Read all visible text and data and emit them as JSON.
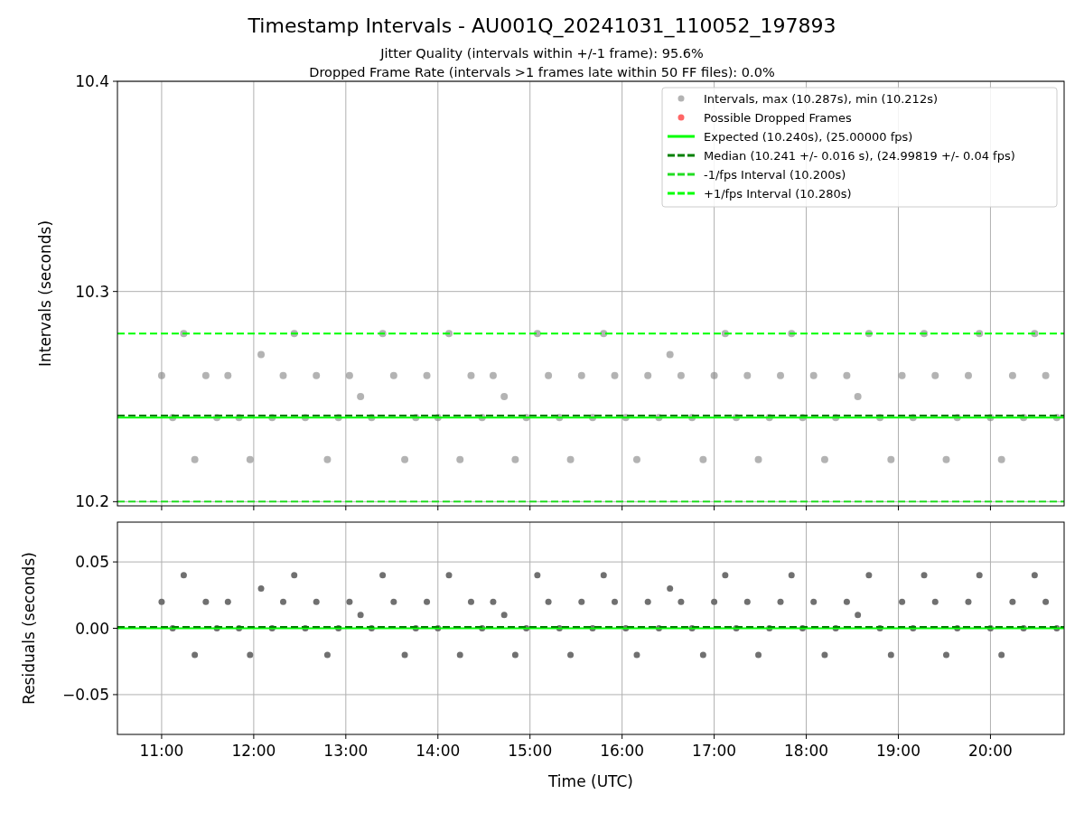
{
  "figure": {
    "title": "Timestamp Intervals - AU001Q_20241031_110052_197893",
    "subtitles": [
      "Jitter Quality (intervals within +/-1 frame): 95.6%",
      "Dropped Frame Rate (intervals >1 frames late within 50 FF files): 0.0%"
    ],
    "panels": [
      {
        "chart_data": {
          "type": "scatter",
          "grid": true,
          "ylabel": "Intervals (seconds)",
          "xlim": [
            10.52,
            20.8
          ],
          "ylim": [
            10.198,
            10.4
          ],
          "yticks": [
            {
              "value": 10.2,
              "label": "10.2"
            },
            {
              "value": 10.3,
              "label": "10.3"
            },
            {
              "value": 10.4,
              "label": "10.4"
            }
          ],
          "x": [
            11,
            11.12,
            11.24,
            11.36,
            11.48,
            11.6,
            11.72,
            11.84,
            11.96,
            12.08,
            12.2,
            12.32,
            12.44,
            12.56,
            12.68,
            12.8,
            12.92,
            13.04,
            13.16,
            13.28,
            13.4,
            13.52,
            13.64,
            13.76,
            13.88,
            14,
            14.12,
            14.24,
            14.36,
            14.48,
            14.6,
            14.72,
            14.84,
            14.96,
            15.08,
            15.2,
            15.32,
            15.44,
            15.56,
            15.68,
            15.8,
            15.92,
            16.04,
            16.16,
            16.28,
            16.4,
            16.52,
            16.64,
            16.76,
            16.88,
            17,
            17.12,
            17.24,
            17.36,
            17.48,
            17.6,
            17.72,
            17.84,
            17.96,
            18.08,
            18.2,
            18.32,
            18.44,
            18.56,
            18.68,
            18.8,
            18.92,
            19.04,
            19.16,
            19.28,
            19.4,
            19.52,
            19.64,
            19.76,
            19.88,
            20,
            20.12,
            20.24,
            20.36,
            20.48,
            20.6,
            20.72
          ],
          "series": [
            {
              "name": "Intervals, max (10.287s), min (10.212s)",
              "color": "#808080",
              "values": [
                10.26,
                10.24,
                10.28,
                10.22,
                10.26,
                10.24,
                10.26,
                10.24,
                10.22,
                10.27,
                10.24,
                10.26,
                10.28,
                10.24,
                10.26,
                10.22,
                10.24,
                10.26,
                10.25,
                10.24,
                10.28,
                10.26,
                10.22,
                10.24,
                10.26,
                10.24,
                10.28,
                10.22,
                10.26,
                10.24,
                10.26,
                10.25,
                10.22,
                10.24,
                10.28,
                10.26,
                10.24,
                10.22,
                10.26,
                10.24,
                10.28,
                10.26,
                10.24,
                10.22,
                10.26,
                10.24,
                10.27,
                10.26,
                10.24,
                10.22,
                10.26,
                10.28,
                10.24,
                10.26,
                10.22,
                10.24,
                10.26,
                10.28,
                10.24,
                10.26,
                10.22,
                10.24,
                10.26,
                10.25,
                10.28,
                10.24,
                10.22,
                10.26,
                10.24,
                10.28,
                10.26,
                10.22,
                10.24,
                10.26,
                10.28,
                10.24,
                10.22,
                10.26,
                10.24,
                10.28,
                10.26,
                10.24
              ]
            }
          ],
          "legend": true,
          "ref_lines": [
            {
              "axis": "y",
              "value": 10.24,
              "label": "Expected (10.240s), (25.00000 fps)",
              "color": "#00ff00"
            },
            {
              "axis": "y",
              "value": 10.241,
              "label": "Median (10.241 +/- 0.016 s), (24.99819 +/- 0.04 fps)",
              "color": "#008000"
            },
            {
              "axis": "y",
              "value": 10.2,
              "label": "-1/fps Interval (10.200s)",
              "color": "#22dd22"
            },
            {
              "axis": "y",
              "value": 10.28,
              "label": "+1/fps Interval (10.280s)",
              "color": "#00ff00"
            }
          ]
        },
        "extra_legend": [
          {
            "label": "Possible Dropped Frames",
            "color": "#ff6666"
          }
        ]
      },
      {
        "chart_data": {
          "type": "scatter",
          "grid": true,
          "xlabel": "Time (UTC)",
          "ylabel": "Residuals (seconds)",
          "xlim": [
            10.52,
            20.8
          ],
          "ylim": [
            -0.08,
            0.08
          ],
          "yticks": [
            {
              "value": -0.05,
              "label": "−0.05"
            },
            {
              "value": 0,
              "label": "0.00"
            },
            {
              "value": 0.05,
              "label": "0.05"
            }
          ],
          "xticks": [
            {
              "value": 11,
              "label": "11:00"
            },
            {
              "value": 12,
              "label": "12:00"
            },
            {
              "value": 13,
              "label": "13:00"
            },
            {
              "value": 14,
              "label": "14:00"
            },
            {
              "value": 15,
              "label": "15:00"
            },
            {
              "value": 16,
              "label": "16:00"
            },
            {
              "value": 17,
              "label": "17:00"
            },
            {
              "value": 18,
              "label": "18:00"
            },
            {
              "value": 19,
              "label": "19:00"
            },
            {
              "value": 20,
              "label": "20:00"
            }
          ],
          "x": [
            11,
            11.12,
            11.24,
            11.36,
            11.48,
            11.6,
            11.72,
            11.84,
            11.96,
            12.08,
            12.2,
            12.32,
            12.44,
            12.56,
            12.68,
            12.8,
            12.92,
            13.04,
            13.16,
            13.28,
            13.4,
            13.52,
            13.64,
            13.76,
            13.88,
            14,
            14.12,
            14.24,
            14.36,
            14.48,
            14.6,
            14.72,
            14.84,
            14.96,
            15.08,
            15.2,
            15.32,
            15.44,
            15.56,
            15.68,
            15.8,
            15.92,
            16.04,
            16.16,
            16.28,
            16.4,
            16.52,
            16.64,
            16.76,
            16.88,
            17,
            17.12,
            17.24,
            17.36,
            17.48,
            17.6,
            17.72,
            17.84,
            17.96,
            18.08,
            18.2,
            18.32,
            18.44,
            18.56,
            18.68,
            18.8,
            18.92,
            19.04,
            19.16,
            19.28,
            19.4,
            19.52,
            19.64,
            19.76,
            19.88,
            20,
            20.12,
            20.24,
            20.36,
            20.48,
            20.6,
            20.72
          ],
          "series": [
            {
              "color": "#707070",
              "values": [
                0.02,
                0,
                0.04,
                -0.02,
                0.02,
                0,
                0.02,
                0,
                -0.02,
                0.03,
                0,
                0.02,
                0.04,
                0,
                0.02,
                -0.02,
                0,
                0.02,
                0.01,
                0,
                0.04,
                0.02,
                -0.02,
                0,
                0.02,
                0,
                0.04,
                -0.02,
                0.02,
                0,
                0.02,
                0.01,
                -0.02,
                0,
                0.04,
                0.02,
                0,
                -0.02,
                0.02,
                0,
                0.04,
                0.02,
                0,
                -0.02,
                0.02,
                0,
                0.03,
                0.02,
                0,
                -0.02,
                0.02,
                0.04,
                0,
                0.02,
                -0.02,
                0,
                0.02,
                0.04,
                0,
                0.02,
                -0.02,
                0,
                0.02,
                0.01,
                0.04,
                0,
                -0.02,
                0.02,
                0,
                0.04,
                0.02,
                -0.02,
                0,
                0.02,
                0.04,
                0,
                -0.02,
                0.02,
                0,
                0.04,
                0.02,
                0
              ]
            }
          ],
          "ref_lines": [
            {
              "axis": "y",
              "value": 0,
              "color": "#00ff00"
            },
            {
              "axis": "y",
              "value": 0.001,
              "color": "#008000"
            }
          ]
        }
      }
    ]
  }
}
